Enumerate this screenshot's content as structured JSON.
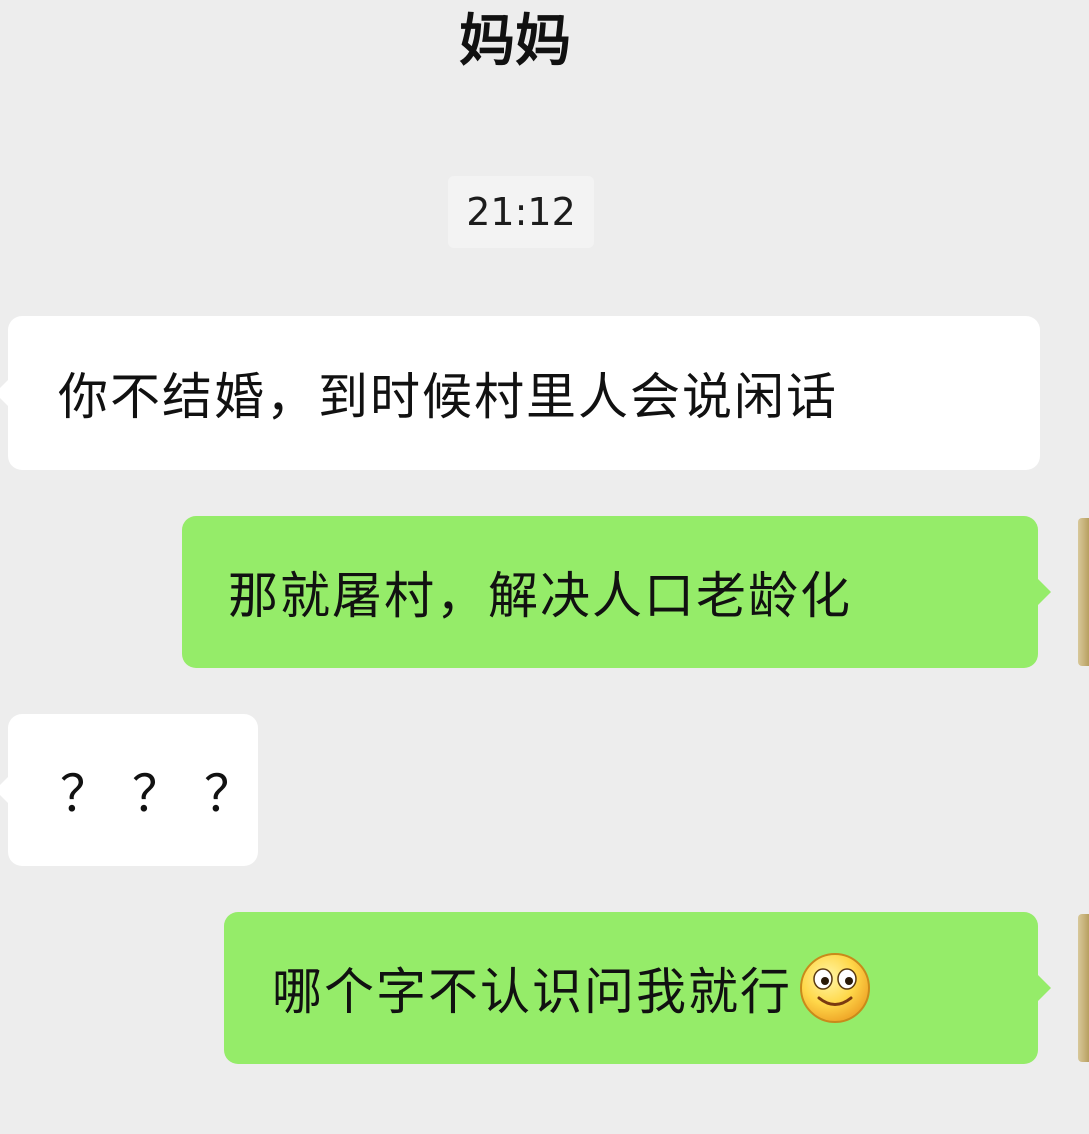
{
  "chat": {
    "title": "妈妈",
    "timestamp": "21:12"
  },
  "messages": [
    {
      "sender": "contact",
      "text": "你不结婚，到时候村里人会说闲话"
    },
    {
      "sender": "me",
      "text": "那就屠村，解决人口老龄化"
    },
    {
      "sender": "contact",
      "text": "？？？"
    },
    {
      "sender": "me",
      "text": "哪个字不认识问我就行",
      "emoji": "smiling-face-icon"
    }
  ],
  "colors": {
    "background": "#ededed",
    "incoming_bubble": "#ffffff",
    "outgoing_bubble": "#95ec69",
    "timestamp_bg": "#f3f3f3"
  }
}
